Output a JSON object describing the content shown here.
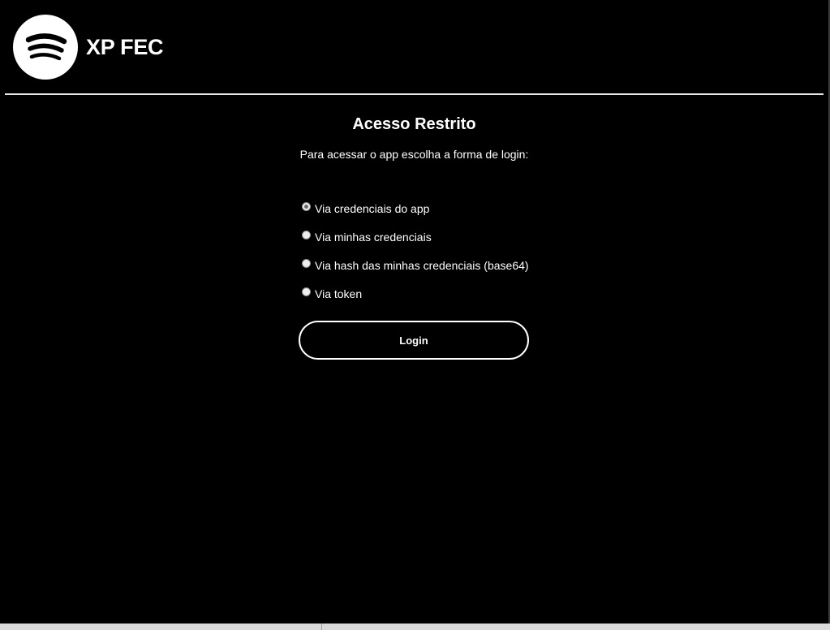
{
  "header": {
    "logo_icon": "spotify-logo-icon",
    "title": "XP FEC"
  },
  "main": {
    "title": "Acesso Restrito",
    "subtitle": "Para acessar o app escolha a forma de login:",
    "login_options": [
      {
        "label": "Via credenciais do app",
        "checked": true
      },
      {
        "label": "Via minhas credenciais",
        "checked": false
      },
      {
        "label": "Via hash das minhas credenciais (base64)",
        "checked": false
      },
      {
        "label": "Via token",
        "checked": false
      }
    ],
    "login_button": "Login"
  },
  "colors": {
    "background": "#000000",
    "text": "#ffffff",
    "logo_background": "#ffffff"
  }
}
